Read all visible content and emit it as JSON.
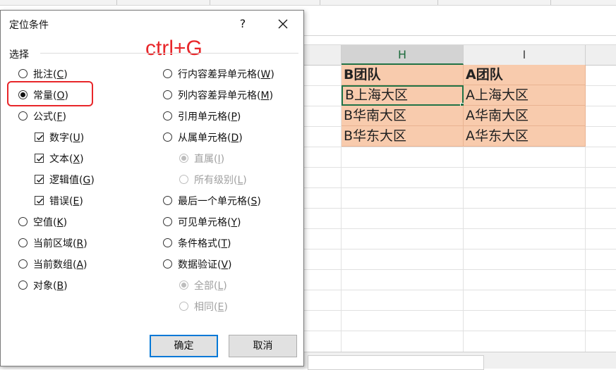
{
  "sheet": {
    "columns": [
      {
        "label": "H"
      },
      {
        "label": "I"
      }
    ],
    "cells": {
      "h_header": "B团队",
      "i_header": "A团队",
      "h_rows": [
        "B上海大区",
        "B华南大区",
        "B华东大区"
      ],
      "i_rows": [
        "A上海大区",
        "A华南大区",
        "A华东大区"
      ]
    }
  },
  "dialog": {
    "title": "定位条件",
    "help": "?",
    "close": "✕",
    "annotation": "ctrl+G",
    "group_label": "选择",
    "left_options": [
      {
        "name": "批注",
        "key": "C",
        "checked": false
      },
      {
        "name": "常量",
        "key": "O",
        "checked": true
      },
      {
        "name": "公式",
        "key": "F",
        "checked": false
      },
      {
        "name": "数字",
        "key": "U",
        "checked": true
      },
      {
        "name": "文本",
        "key": "X",
        "checked": true
      },
      {
        "name": "逻辑值",
        "key": "G",
        "checked": true
      },
      {
        "name": "错误",
        "key": "E",
        "checked": true
      },
      {
        "name": "空值",
        "key": "K",
        "checked": false
      },
      {
        "name": "当前区域",
        "key": "R",
        "checked": false
      },
      {
        "name": "当前数组",
        "key": "A",
        "checked": false
      },
      {
        "name": "对象",
        "key": "B",
        "checked": false
      }
    ],
    "right_options": [
      {
        "name": "行内容差异单元格",
        "key": "W",
        "checked": false
      },
      {
        "name": "列内容差异单元格",
        "key": "M",
        "checked": false
      },
      {
        "name": "引用单元格",
        "key": "P",
        "checked": false
      },
      {
        "name": "从属单元格",
        "key": "D",
        "checked": false
      },
      {
        "name": "直属",
        "key": "I",
        "checked": true
      },
      {
        "name": "所有级别",
        "key": "L",
        "checked": false
      },
      {
        "name": "最后一个单元格",
        "key": "S",
        "checked": false
      },
      {
        "name": "可见单元格",
        "key": "Y",
        "checked": false
      },
      {
        "name": "条件格式",
        "key": "T",
        "checked": false
      },
      {
        "name": "数据验证",
        "key": "V",
        "checked": false
      },
      {
        "name": "全部",
        "key": "L",
        "checked": true
      },
      {
        "name": "相同",
        "key": "E",
        "checked": false
      }
    ],
    "ok_label": "确定",
    "cancel_label": "取消"
  }
}
